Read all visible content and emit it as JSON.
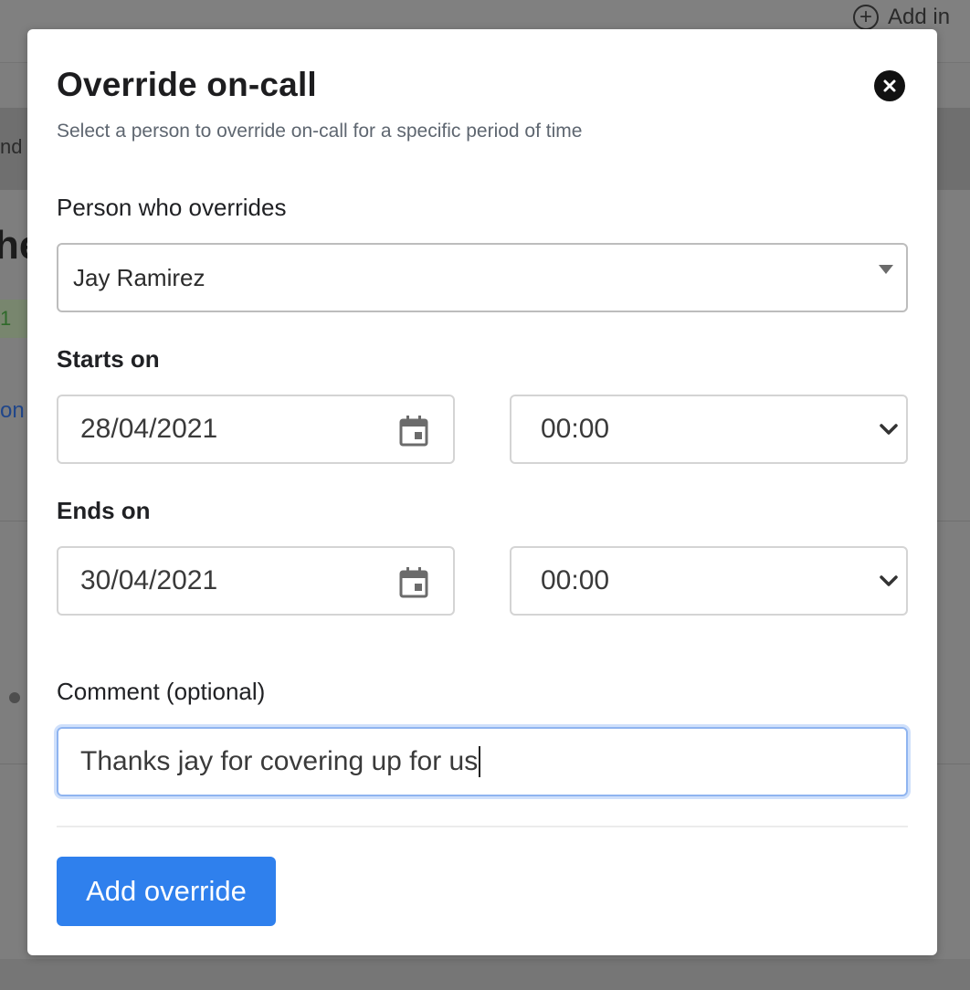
{
  "background": {
    "add_button_label": "Add in",
    "band_text": "nd",
    "heading_fragment": "he",
    "green_badge_text": "1",
    "link_fragment": "on"
  },
  "modal": {
    "title": "Override on-call",
    "subtitle": "Select a person to override on-call for a specific period of time",
    "person_label": "Person who overrides",
    "person_value": "Jay Ramirez",
    "starts_label": "Starts on",
    "starts_date": "28/04/2021",
    "starts_time": "00:00",
    "ends_label": "Ends on",
    "ends_date": "30/04/2021",
    "ends_time": "00:00",
    "comment_label": "Comment (optional)",
    "comment_value": "Thanks jay for covering up for us",
    "submit_label": "Add override"
  },
  "colors": {
    "primary": "#2f80ed",
    "overlay": "#7e7e7e",
    "focus_ring": "#8fb4f0"
  },
  "icons": [
    "plus-circle-icon",
    "close-icon",
    "caret-down-icon",
    "calendar-icon",
    "chevron-down-icon"
  ]
}
